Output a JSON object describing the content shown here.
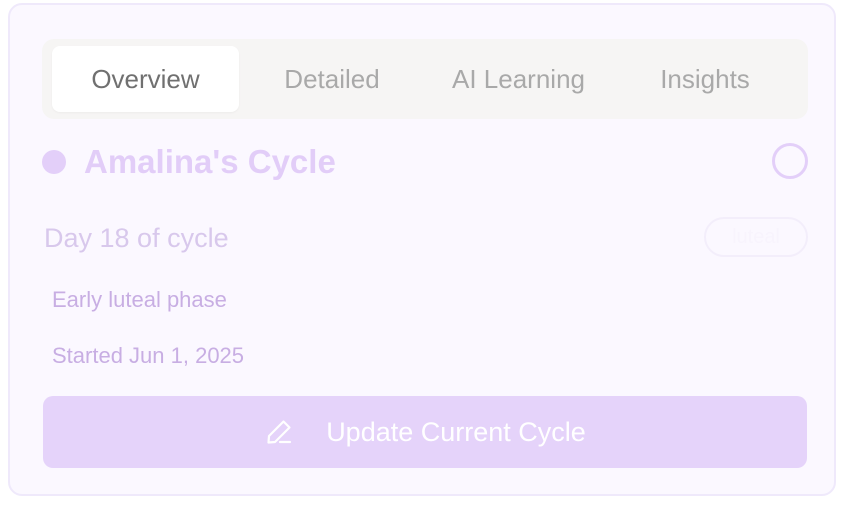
{
  "tabs": [
    {
      "label": "Overview",
      "active": true
    },
    {
      "label": "Detailed",
      "active": false
    },
    {
      "label": "AI Learning",
      "active": false
    },
    {
      "label": "Insights",
      "active": false
    }
  ],
  "cycle": {
    "title": "Amalina's Cycle",
    "day_text": "Day 18 of cycle",
    "phase_badge": "luteal",
    "phase_text": "Early luteal phase",
    "started_text": "Started Jun 1, 2025"
  },
  "actions": {
    "update_label": "Update Current Cycle"
  },
  "icons": {
    "update": "pencil-icon",
    "status": "status-dot"
  },
  "colors": {
    "accent": "#e5d3fa",
    "title": "#e2cdf8",
    "muted_text": "#c8aee3"
  }
}
